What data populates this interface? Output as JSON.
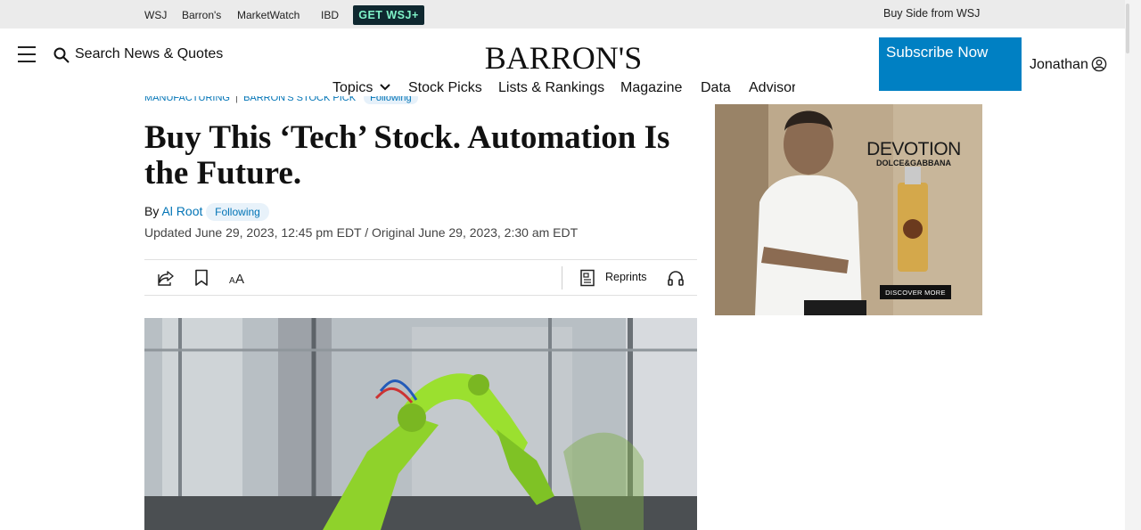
{
  "topbar": {
    "links": [
      "WSJ",
      "Barron's",
      "MarketWatch",
      "IBD"
    ],
    "cta": "GET WSJ+",
    "buy_side": "Buy Side from WSJ"
  },
  "header": {
    "search_label": "Search News & Quotes",
    "logo": "BARRON'S",
    "subscribe": "Subscribe Now",
    "user": "Jonathan"
  },
  "nav": {
    "items": [
      "Topics",
      "Stock Picks",
      "Lists & Rankings",
      "Magazine",
      "Data",
      "Advisor"
    ]
  },
  "article": {
    "breadcrumbs": [
      "MANUFACTURING",
      "BARRON'S STOCK PICK"
    ],
    "breadcrumb_follow": "Following",
    "headline": "Buy This ‘Tech’ Stock. Automation Is the Future.",
    "by": "By",
    "author": "Al Root",
    "author_follow": "Following",
    "dates": "Updated June 29, 2023, 12:45 pm EDT / Original June 29, 2023, 2:30 am EDT",
    "reprints": "Reprints"
  },
  "ad": {
    "brand_line1": "DEVOTION",
    "brand_line2": "DOLCE&GABBANA",
    "button": "DISCOVER MORE"
  },
  "colors": {
    "accent_blue": "#0080c3",
    "link_blue": "#0274b6",
    "cta_bg": "#0f2830",
    "cta_text": "#7ff3c8"
  }
}
